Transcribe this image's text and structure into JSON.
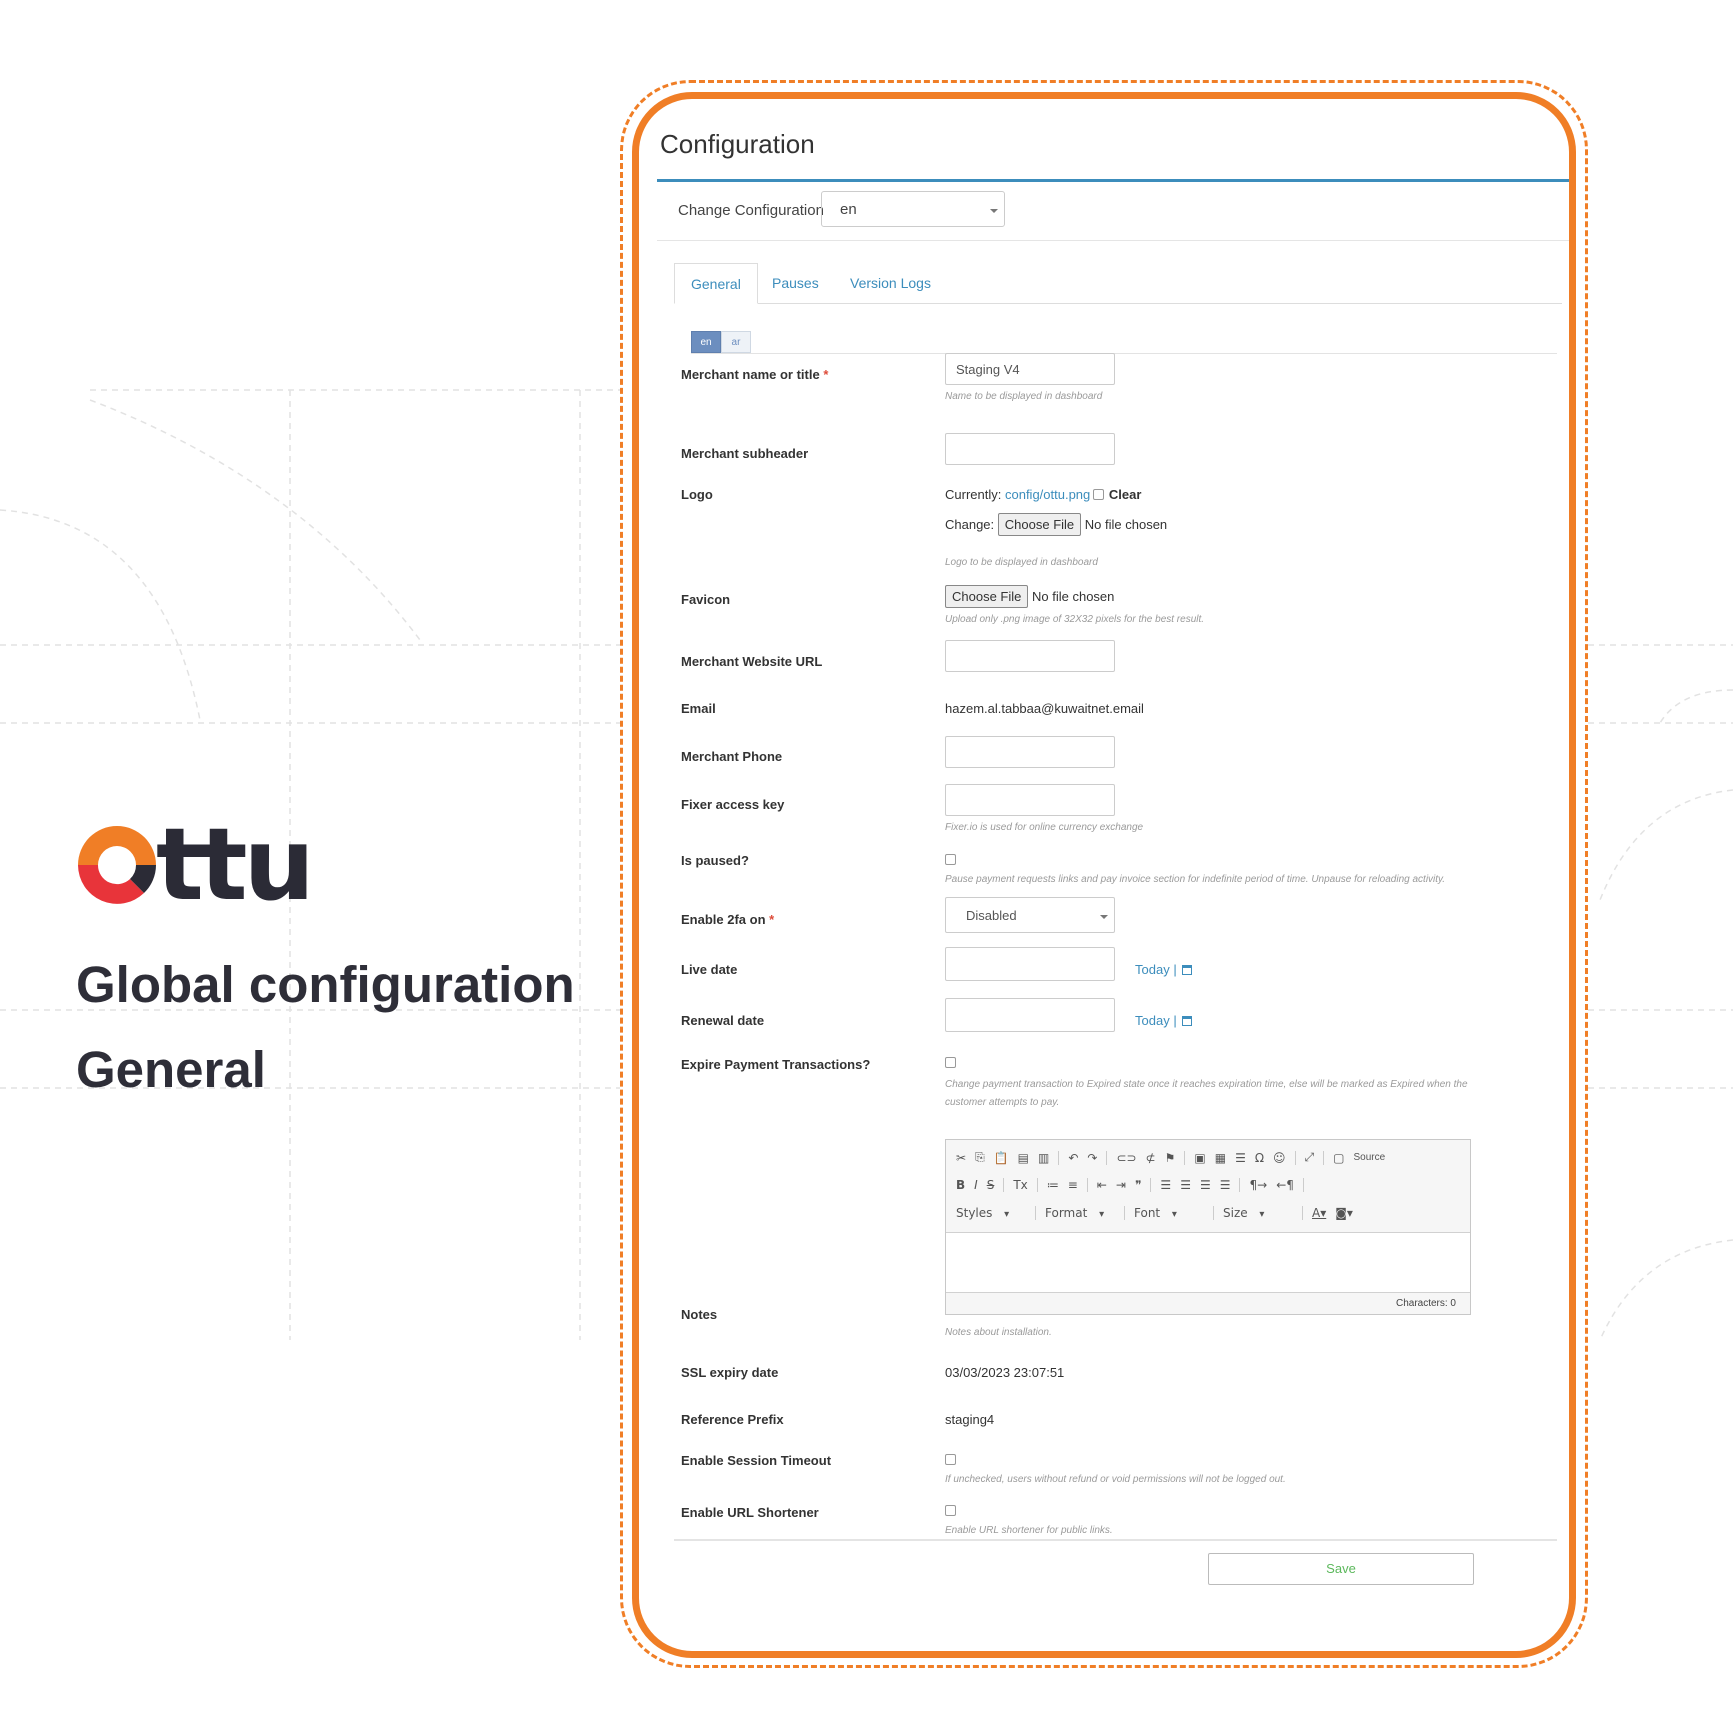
{
  "brand": {
    "logo_text": "ttu",
    "headline": "Global configuration",
    "subheadline": "General",
    "accent_color": "#f07e26",
    "logo_colors": [
      "#f07e26",
      "#e8343a"
    ]
  },
  "config": {
    "title": "Configuration",
    "change_label": "Change Configuration",
    "change_value": "en",
    "tabs": [
      {
        "label": "General"
      },
      {
        "label": "Pauses"
      },
      {
        "label": "Version Logs"
      }
    ],
    "languages": [
      "en",
      "ar"
    ]
  },
  "form": {
    "merchant_name": {
      "label": "Merchant name or title",
      "value": "Staging V4",
      "help": "Name to be displayed in dashboard"
    },
    "merchant_subheader": {
      "label": "Merchant subheader"
    },
    "logo": {
      "label": "Logo",
      "currently_label": "Currently:",
      "current_file": "config/ottu.png",
      "clear_label": "Clear",
      "change_label": "Change:",
      "choose_label": "Choose File",
      "no_file": "No file chosen",
      "help": "Logo to be displayed in dashboard"
    },
    "favicon": {
      "label": "Favicon",
      "choose_label": "Choose File",
      "no_file": "No file chosen",
      "help": "Upload only .png image of 32X32 pixels for the best result."
    },
    "website": {
      "label": "Merchant Website URL"
    },
    "email": {
      "label": "Email",
      "value": "hazem.al.tabbaa@kuwaitnet.email"
    },
    "phone": {
      "label": "Merchant Phone"
    },
    "fixer": {
      "label": "Fixer access key",
      "help": "Fixer.io is used for online currency exchange"
    },
    "paused": {
      "label": "Is paused?",
      "help": "Pause payment requests links and pay invoice section for indefinite period of time. Unpause for reloading activity."
    },
    "twofa": {
      "label": "Enable 2fa on",
      "value": "Disabled"
    },
    "live_date": {
      "label": "Live date",
      "today": "Today"
    },
    "renewal_date": {
      "label": "Renewal date",
      "today": "Today"
    },
    "expire": {
      "label": "Expire Payment Transactions?",
      "help_line1": "Change payment transaction to Expired state once it reaches expiration time, else will be marked as Expired when the",
      "help_line2": "customer attempts to pay."
    },
    "notes": {
      "label": "Notes",
      "help": "Notes about installation.",
      "characters": "Characters: 0",
      "source_label": "Source",
      "styles": "Styles",
      "format": "Format",
      "font": "Font",
      "size": "Size"
    },
    "ssl": {
      "label": "SSL expiry date",
      "value": "03/03/2023 23:07:51"
    },
    "prefix": {
      "label": "Reference Prefix",
      "value": "staging4"
    },
    "session": {
      "label": "Enable Session Timeout",
      "help": "If unchecked, users without refund or void permissions will not be logged out."
    },
    "shortener": {
      "label": "Enable URL Shortener",
      "help": "Enable URL shortener for public links."
    },
    "save_label": "Save"
  }
}
